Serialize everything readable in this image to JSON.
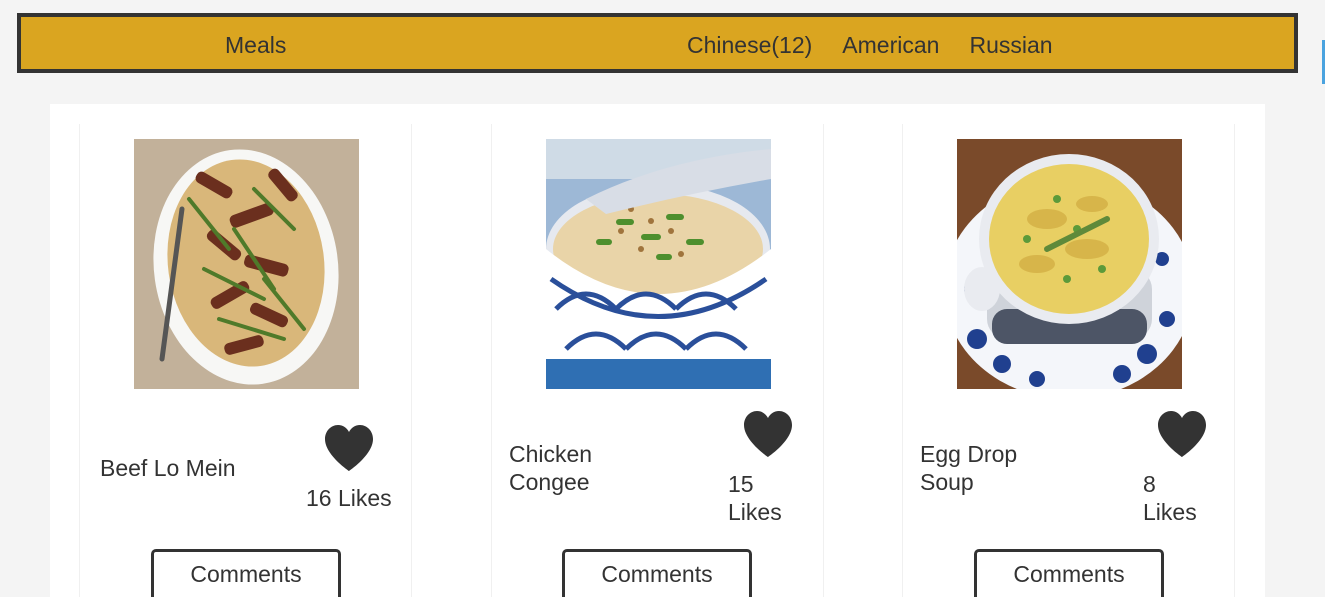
{
  "nav": {
    "brand": "Meals",
    "links": [
      "Chinese(12)",
      "American",
      "Russian"
    ]
  },
  "colors": {
    "navbar_bg": "#daa520",
    "text": "#333333",
    "page_bg": "#f4f4f4"
  },
  "meals": [
    {
      "name": "Beef Lo Mein",
      "likes_count": "16",
      "likes_label": "Likes",
      "comments_label": "Comments",
      "image": "beef-lo-mein-photo"
    },
    {
      "name": "Chicken Congee",
      "likes_count": "15",
      "likes_label": "Likes",
      "comments_label": "Comments",
      "image": "chicken-congee-photo"
    },
    {
      "name": "Egg Drop Soup",
      "likes_count": "8",
      "likes_label": "Likes",
      "comments_label": "Comments",
      "image": "egg-drop-soup-photo"
    }
  ],
  "icons": {
    "like": "heart-icon"
  }
}
